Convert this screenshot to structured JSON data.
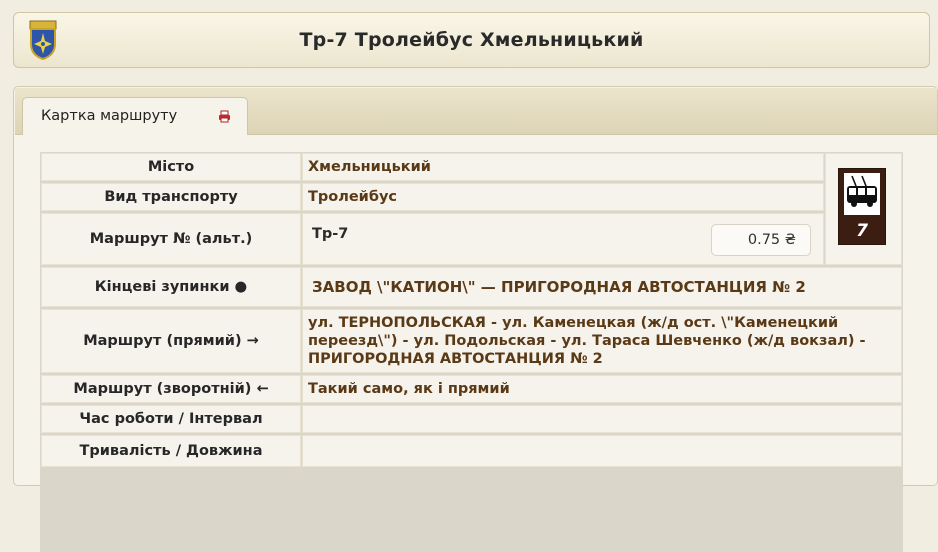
{
  "header": {
    "title": "Тр-7 Тролейбус Хмельницький"
  },
  "tab": {
    "label": "Картка маршруту"
  },
  "rows": [
    {
      "label": "Місто",
      "value": "Хмельницький"
    },
    {
      "label": "Вид транспорту",
      "value": "Тролейбус"
    },
    {
      "label": "Маршрут № (альт.)",
      "value": "Тр-7"
    },
    {
      "label": "Кінцеві зупинки ●",
      "value": "ЗАВОД \\\"КАТИОН\\\" — ПРИГОРОДНАЯ АВТОСТАНЦИЯ № 2"
    },
    {
      "label": "Маршрут (прямий) →",
      "value": "ул. ТЕРНОПОЛЬСКАЯ - ул. Каменецкая (ж/д ост. \\\"Каменецкий переезд\\\") - ул. Подольская - ул. Тараса Шевченко (ж/д вокзал) - ПРИГОРОДНАЯ АВТОСТАНЦИЯ № 2"
    },
    {
      "label": "Маршрут (зворотній) ←",
      "value": "Такий само, як і прямий"
    },
    {
      "label": "Час роботи / Інтервал",
      "value": ""
    },
    {
      "label": "Тривалість / Довжина",
      "value": ""
    }
  ],
  "fare": "0.75 ₴",
  "badge": {
    "number": "7",
    "icon": "trolleybus-icon"
  },
  "icons": {
    "coat_of_arms": "coat-of-arms-icon",
    "print": "print-icon"
  },
  "colors": {
    "value_text": "#5a3a16",
    "badge_bg": "#3b1e11",
    "background": "#f1ede0"
  }
}
